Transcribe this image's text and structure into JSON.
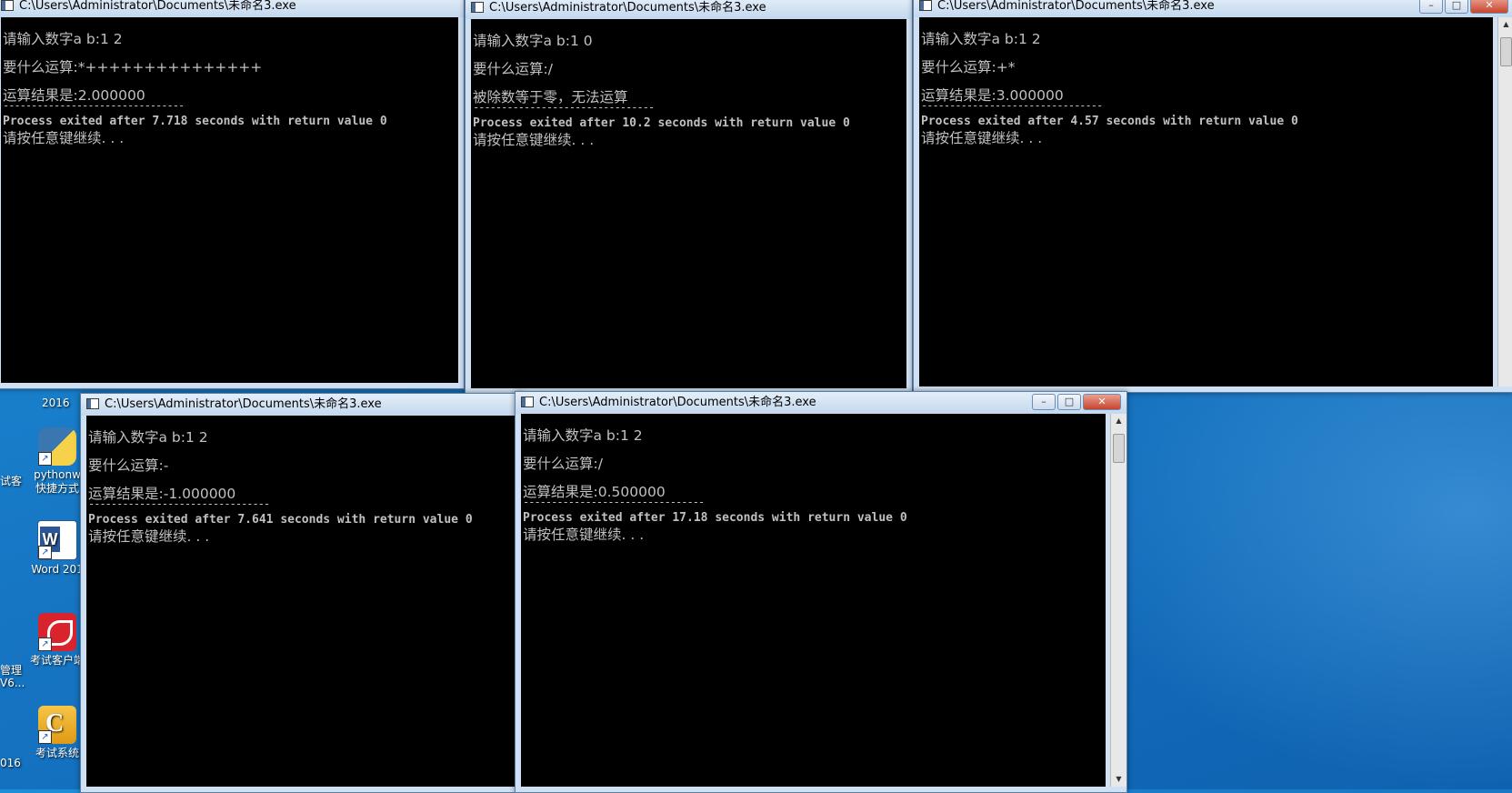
{
  "colors": {
    "desktop": "#1676c4",
    "console_bg": "#000000",
    "console_text": "#c0c0c0"
  },
  "desktop": {
    "year_label": "2016",
    "icons": [
      {
        "name": "pythonw-shortcut",
        "label1": "pythonw",
        "label2": "快捷方式",
        "icon": "python-icon"
      },
      {
        "name": "word-2016",
        "label1": "Word 201",
        "label2": "",
        "icon": "word-icon"
      },
      {
        "name": "exam-client",
        "label1": "考试客户端",
        "label2": "",
        "icon": "exam-client-icon"
      },
      {
        "name": "exam-system",
        "label1": "考试系统",
        "label2": "",
        "icon": "exam-system-icon"
      }
    ],
    "partial_labels": [
      "试客",
      "管理",
      "V6...",
      "016"
    ]
  },
  "windows": [
    {
      "title": "C:\\Users\\Administrator\\Documents\\未命名3.exe",
      "lines": {
        "prompt": "请输入数字a b:1 2",
        "op": "要什么运算:*+++++++++++++++",
        "result": "运算结果是:2.000000",
        "sep": "--------------------------------",
        "process": "Process exited after 7.718 seconds with return value 0",
        "press": "请按任意键继续. . ."
      }
    },
    {
      "title": "C:\\Users\\Administrator\\Documents\\未命名3.exe",
      "lines": {
        "prompt": "请输入数字a b:1 0",
        "op": "要什么运算:/",
        "result": "被除数等于零，无法运算",
        "sep": "--------------------------------",
        "process": "Process exited after 10.2 seconds with return value 0",
        "press": "请按任意键继续. . ."
      }
    },
    {
      "title": "C:\\Users\\Administrator\\Documents\\未命名3.exe",
      "lines": {
        "prompt": "请输入数字a b:1 2",
        "op": "要什么运算:+*",
        "result": "运算结果是:3.000000",
        "sep": "--------------------------------",
        "process": "Process exited after 4.57 seconds with return value 0",
        "press": "请按任意键继续. . ."
      }
    },
    {
      "title": "C:\\Users\\Administrator\\Documents\\未命名3.exe",
      "lines": {
        "prompt": "请输入数字a b:1 2",
        "op": "要什么运算:-",
        "result": "运算结果是:-1.000000",
        "sep": "--------------------------------",
        "process": "Process exited after 7.641 seconds with return value 0",
        "press": "请按任意键继续. . ."
      }
    },
    {
      "title": "C:\\Users\\Administrator\\Documents\\未命名3.exe",
      "lines": {
        "prompt": "请输入数字a b:1 2",
        "op": "要什么运算:/",
        "result": "运算结果是:0.500000",
        "sep": "--------------------------------",
        "process": "Process exited after 17.18 seconds with return value 0",
        "press": "请按任意键继续. . ."
      }
    }
  ]
}
